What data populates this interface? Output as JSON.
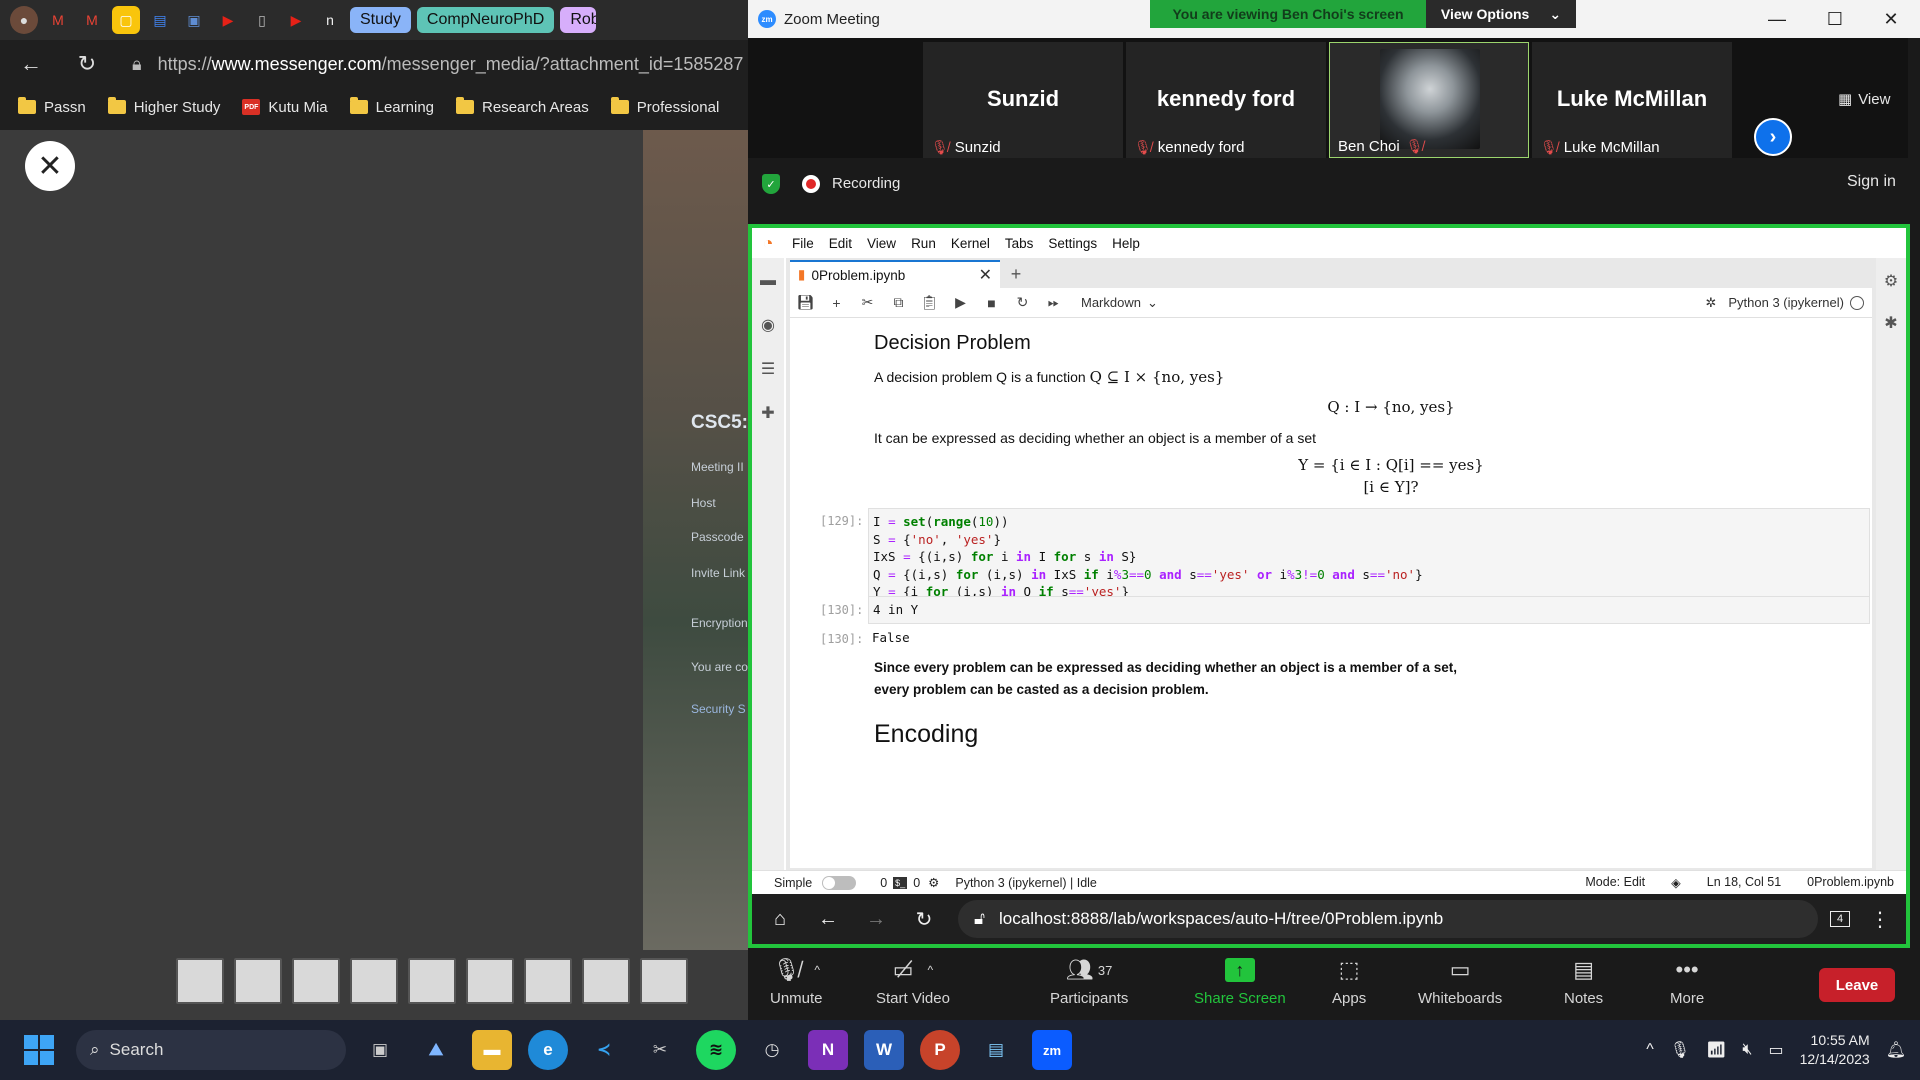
{
  "browser": {
    "tab_groups": [
      "Study",
      "CompNeuroPhD",
      "Robo"
    ],
    "url_prefix": "https://",
    "url_domain": "www.messenger.com",
    "url_path": "/messenger_media/?attachment_id=1585287",
    "bookmarks": [
      "Passn",
      "Higher Study",
      "Kutu Mia",
      "Learning",
      "Research Areas",
      "Professional"
    ],
    "viewer_captions": [
      "CSC5:",
      "Meeting II",
      "Host",
      "Passcode",
      "Invite Link",
      "Encryption",
      "You are co",
      "Security S"
    ]
  },
  "zoom": {
    "title": "Zoom Meeting",
    "banner": "You are viewing Ben Choi's screen",
    "view_options": "View Options",
    "view_label": "View",
    "participants": [
      {
        "display": "Sunzid",
        "label": "Sunzid",
        "muted": true
      },
      {
        "display": "kennedy ford",
        "label": "kennedy ford",
        "muted": true
      },
      {
        "display": "",
        "label": "Ben Choi",
        "muted": true
      },
      {
        "display": "Luke McMillan",
        "label": "Luke McMillan",
        "muted": true
      }
    ],
    "recording": "Recording",
    "sign_in": "Sign in",
    "toolbar": {
      "unmute": "Unmute",
      "start_video": "Start Video",
      "participants": "Participants",
      "participant_count": "37",
      "share_screen": "Share Screen",
      "apps": "Apps",
      "whiteboards": "Whiteboards",
      "notes": "Notes",
      "more": "More",
      "leave": "Leave"
    }
  },
  "jupyter": {
    "menu": [
      "File",
      "Edit",
      "View",
      "Run",
      "Kernel",
      "Tabs",
      "Settings",
      "Help"
    ],
    "tab_name": "0Problem.ipynb",
    "cell_type": "Markdown",
    "kernel": "Python 3 (ipykernel)",
    "heading1": "Decision Problem",
    "para1_text": "A decision problem Q is a function ",
    "para1_math": "Q ⊆ I × {no, yes}",
    "eq1": "Q : I → {no, yes}",
    "para2": "It can be expressed as deciding whether an object is a member of a set",
    "eq2": "Y = {i ∈ I : Q[i] == yes}",
    "eq3": "[i ∈ Y]?",
    "prompt1": "[129]:",
    "prompt2": "[130]:",
    "prompt3": "[130]:",
    "code2": "4 in Y",
    "output": "False",
    "bold1": "Since every problem can be expressed as deciding whether an object is a member of a set,",
    "bold2": "every problem can be casted as a decision problem.",
    "heading2": "Encoding",
    "status": {
      "mode_simple": "Simple",
      "zero1": "0",
      "zero2": "0",
      "kernel_status": "Python 3 (ipykernel) | Idle",
      "mode": "Mode: Edit",
      "position": "Ln 18, Col 51",
      "file": "0Problem.ipynb"
    }
  },
  "edge": {
    "url": "localhost:8888/lab/workspaces/auto-H/tree/0Problem.ipynb",
    "tab_count": "4"
  },
  "taskbar": {
    "search": "Search",
    "time": "10:55 AM",
    "date": "12/14/2023"
  },
  "colors": {
    "zoom_green": "#22c43c",
    "zoom_blue": "#0e71eb",
    "leave_red": "#c7202a",
    "jupyter_orange": "#f37626"
  }
}
